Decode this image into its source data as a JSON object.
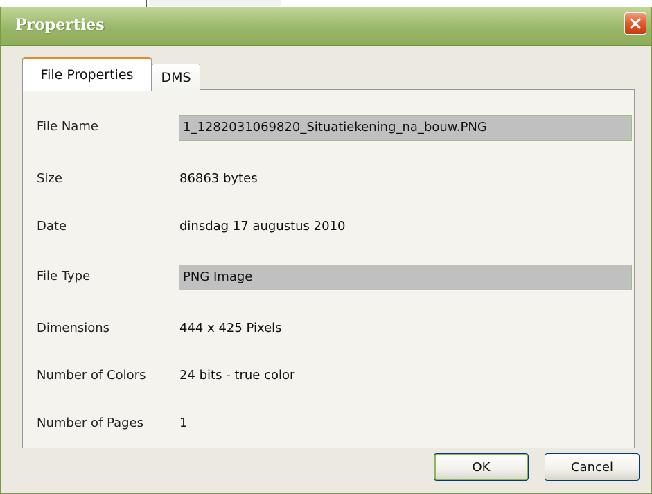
{
  "window": {
    "title": "Properties"
  },
  "tabs": [
    {
      "label": "File Properties",
      "active": true
    },
    {
      "label": "DMS",
      "active": false
    }
  ],
  "properties": {
    "file_name": {
      "label": "File Name",
      "value": "1_1282031069820_Situatiekening_na_bouw.PNG"
    },
    "size": {
      "label": "Size",
      "value": "86863 bytes"
    },
    "date": {
      "label": "Date",
      "value": "dinsdag 17 augustus 2010"
    },
    "file_type": {
      "label": "File Type",
      "value": "PNG Image"
    },
    "dimensions": {
      "label": "Dimensions",
      "value": "444 x 425 Pixels"
    },
    "colors": {
      "label": "Number of Colors",
      "value": "24 bits - true color"
    },
    "pages": {
      "label": "Number of Pages",
      "value": "1"
    }
  },
  "buttons": {
    "ok_label": "OK",
    "cancel_label": "Cancel"
  },
  "icons": {
    "close": "close-icon"
  },
  "colors": {
    "titlebar": "#97b566",
    "close_button": "#e25a2a",
    "active_tab_accent": "#e68b2c",
    "field_background": "#c0c0c0"
  }
}
